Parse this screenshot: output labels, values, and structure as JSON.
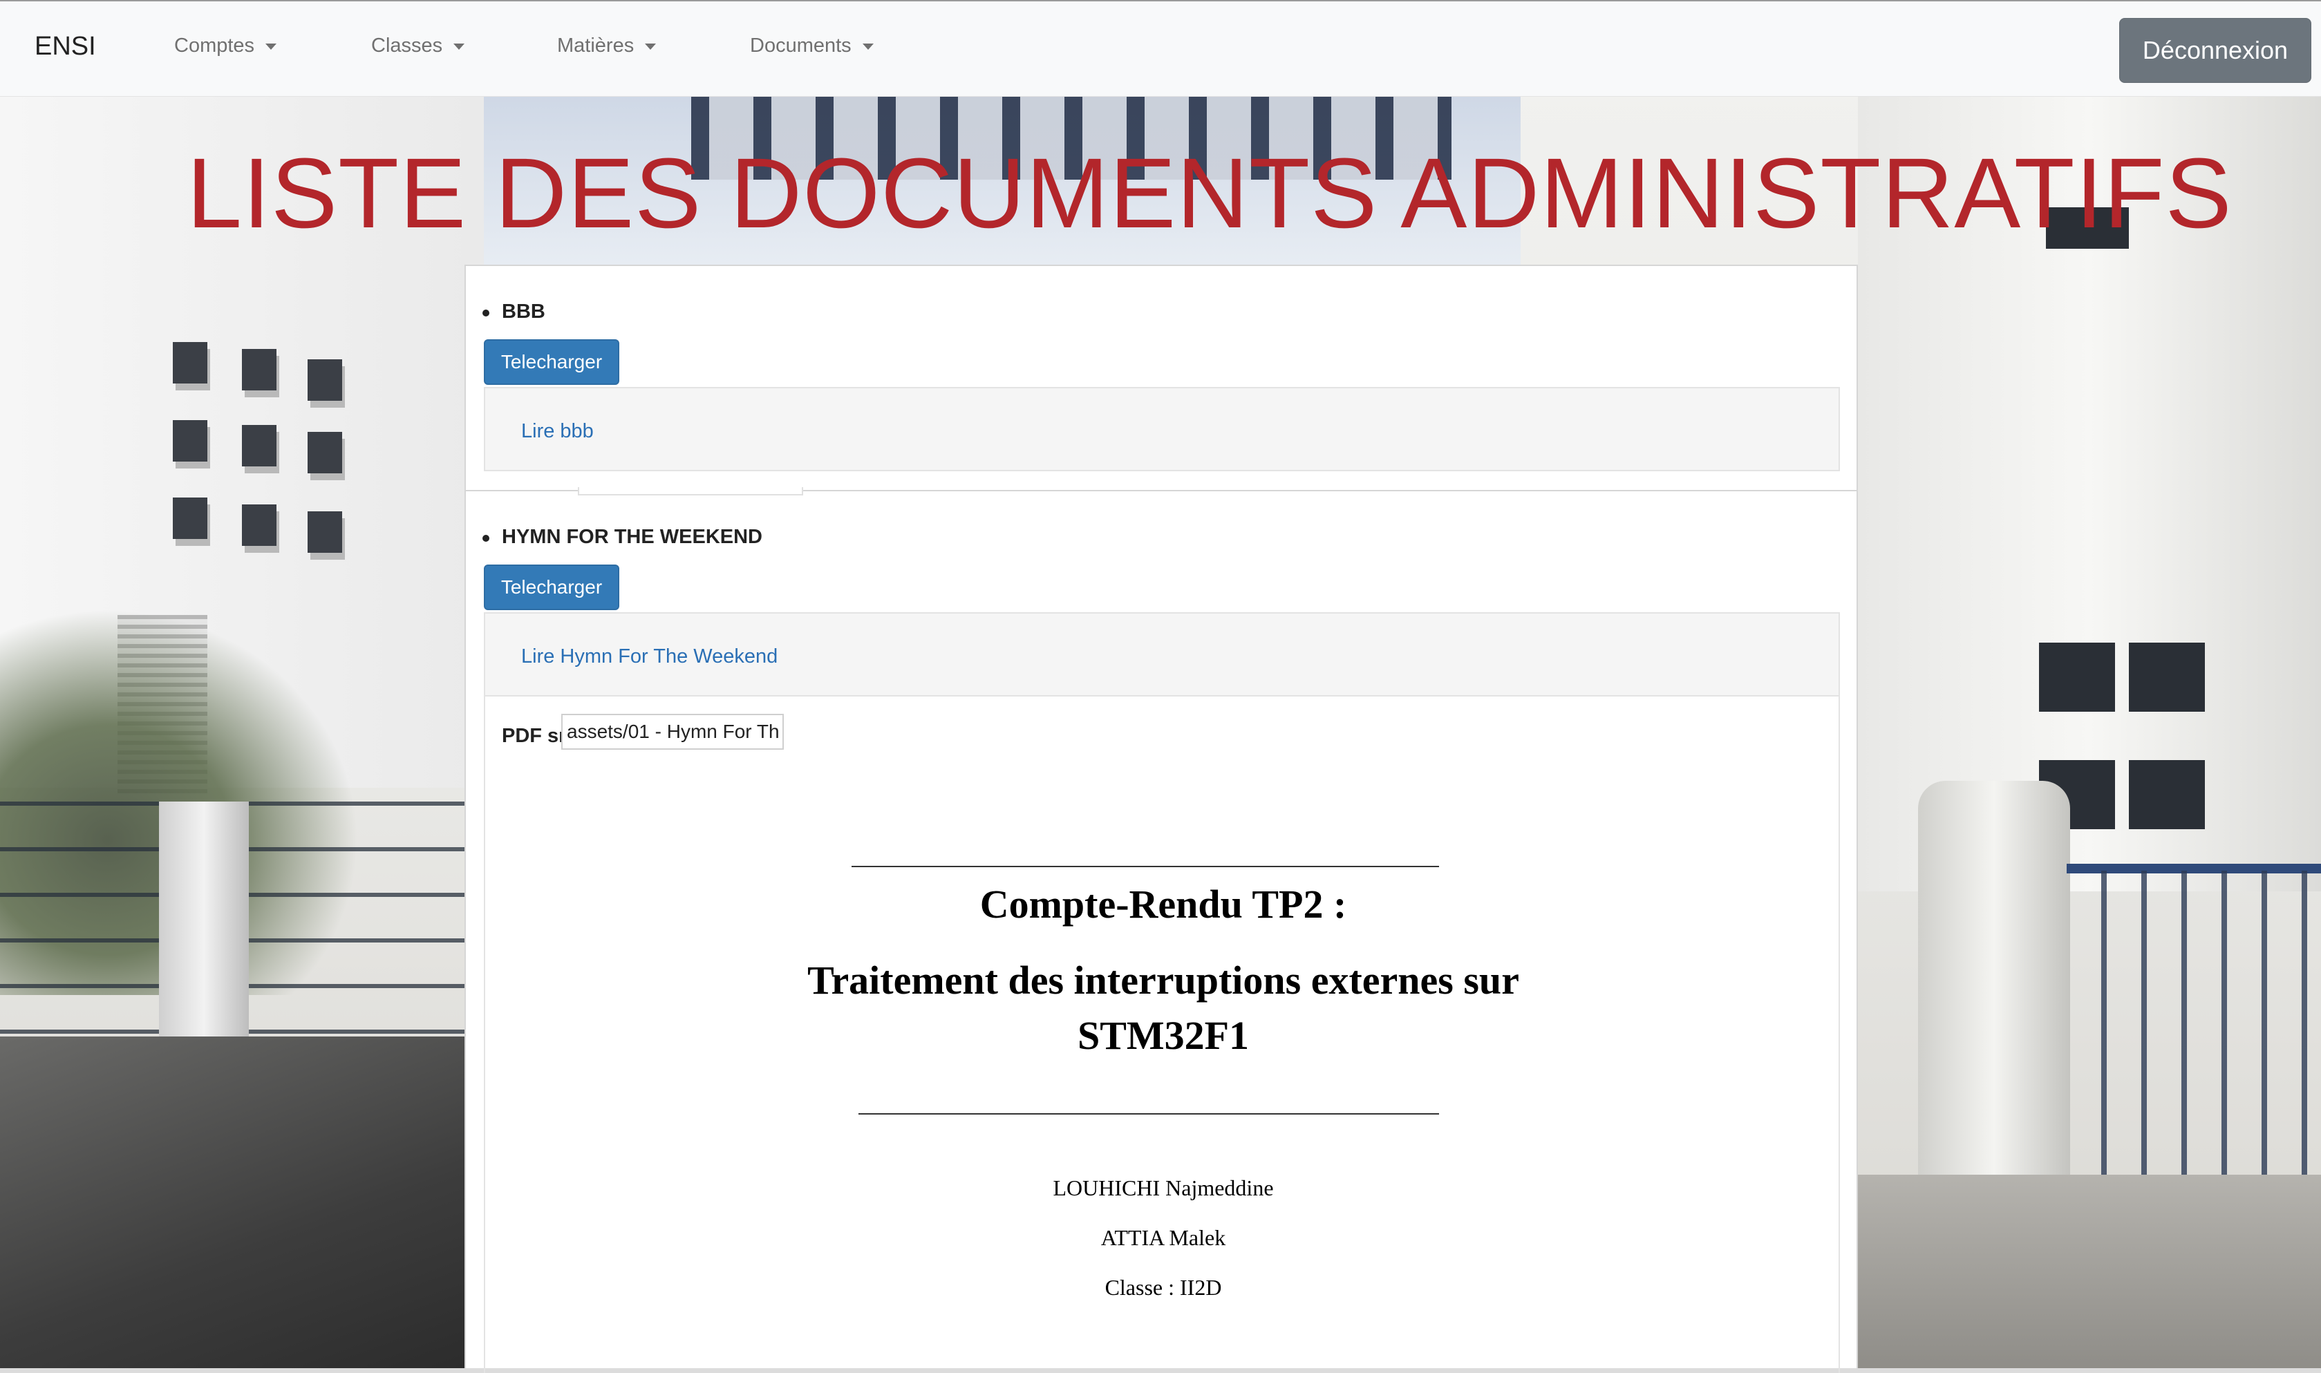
{
  "navbar": {
    "brand": "ENSI",
    "menus": [
      {
        "label": "Comptes"
      },
      {
        "label": "Classes"
      },
      {
        "label": "Matières"
      },
      {
        "label": "Documents"
      }
    ],
    "logout_label": "Déconnexion"
  },
  "page": {
    "title": "LISTE DES DOCUMENTS ADMINISTRATIFS"
  },
  "documents": [
    {
      "name": "BBB",
      "download_label": "Telecharger",
      "read_link": "Lire bbb"
    },
    {
      "name": "HYMN FOR THE WEEKEND",
      "download_label": "Telecharger",
      "read_link": "Lire Hymn For The Weekend",
      "pdf_src_label": "PDF src",
      "pdf_src_value": "assets/01 - Hymn For Th",
      "pdf_preview": {
        "title": "Compte-Rendu TP2 :",
        "subtitle_line1": "Traitement des interruptions externes sur",
        "subtitle_line2": "STM32F1",
        "authors": [
          "LOUHICHI Najmeddine",
          "ATTIA Malek"
        ],
        "class_line": "Classe : II2D"
      }
    }
  ],
  "colors": {
    "title_red": "#b3262b",
    "primary_button": "#337ab7",
    "link_blue": "#2a6fb5",
    "logout_gray": "#6c757d"
  }
}
